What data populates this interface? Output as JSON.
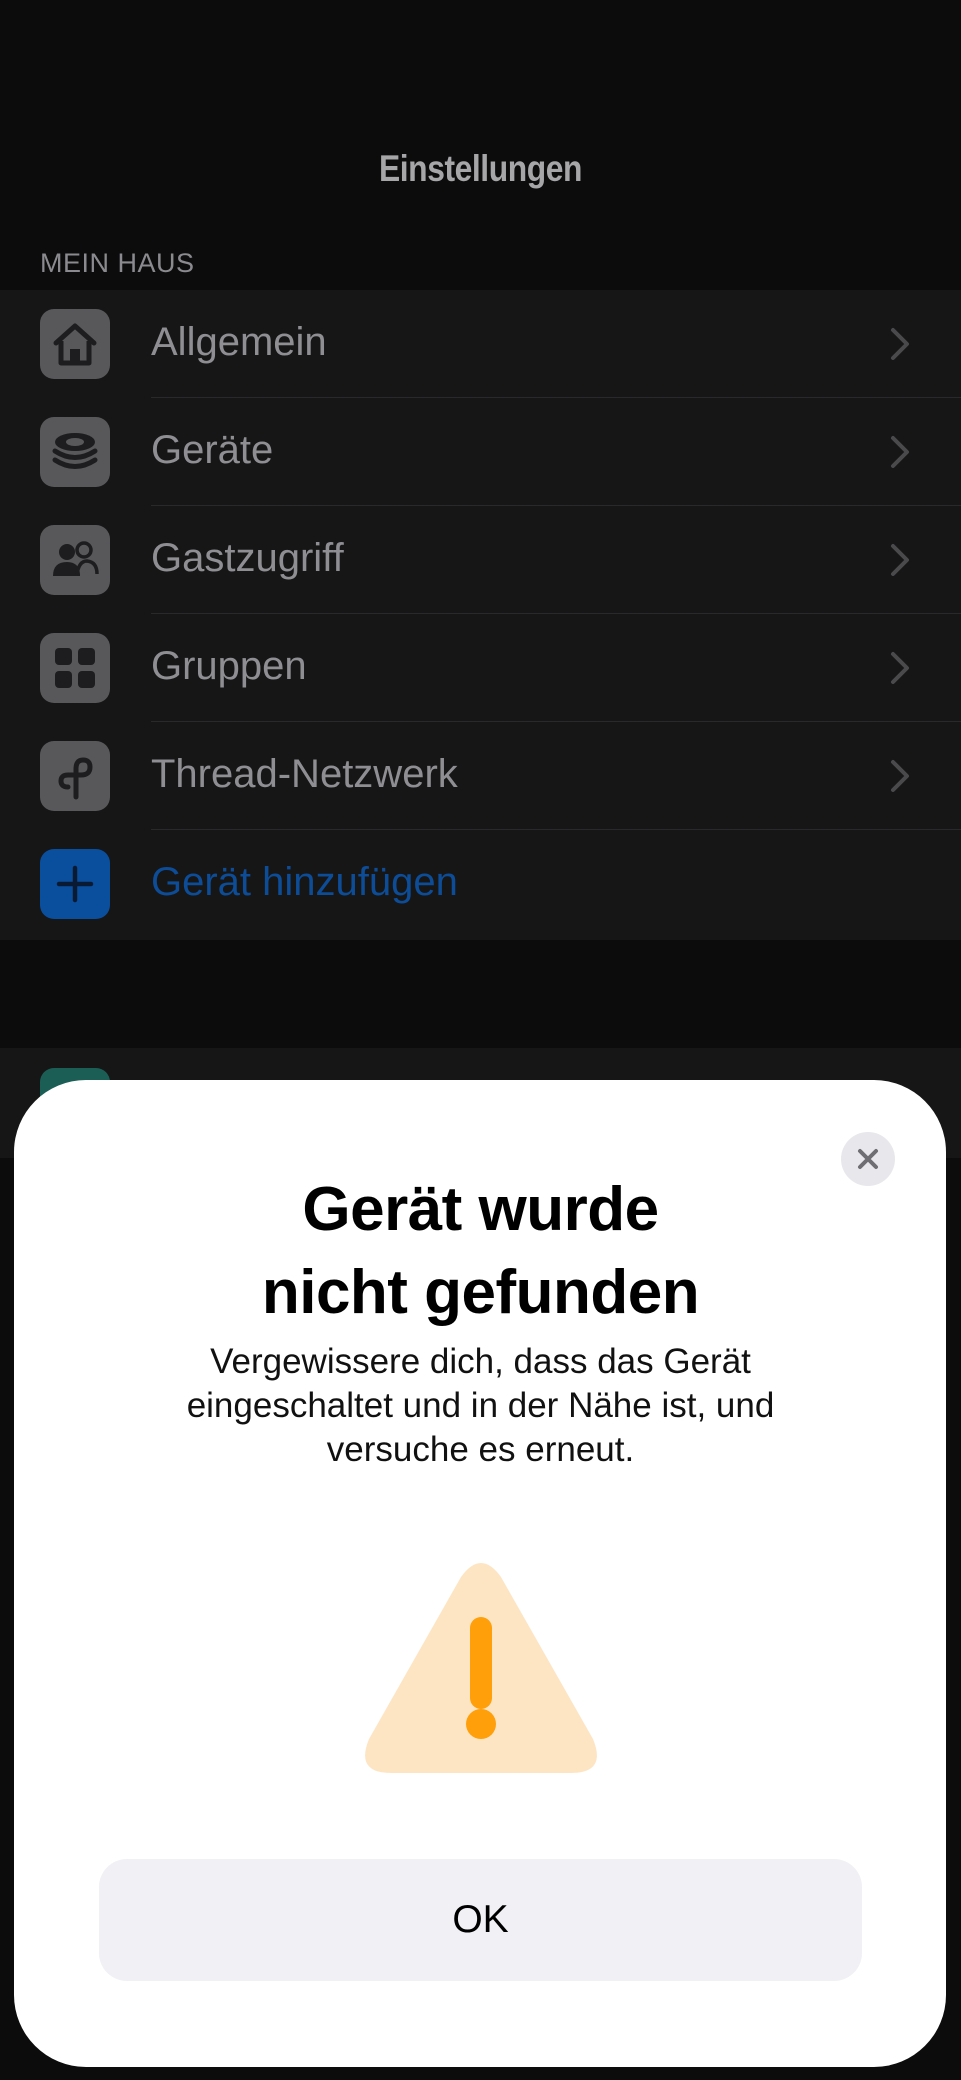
{
  "header": {
    "title": "Einstellungen"
  },
  "section": {
    "header": "MEIN HAUS"
  },
  "menu": {
    "items": [
      {
        "label": "Allgemein",
        "icon": "house-icon"
      },
      {
        "label": "Geräte",
        "icon": "devices-stack-icon"
      },
      {
        "label": "Gastzugriff",
        "icon": "guest-access-icon"
      },
      {
        "label": "Gruppen",
        "icon": "groups-grid-icon"
      },
      {
        "label": "Thread-Netzwerk",
        "icon": "thread-network-icon"
      },
      {
        "label": "Gerät hinzufügen",
        "icon": "plus-icon"
      }
    ]
  },
  "modal": {
    "title_line1": "Gerät wurde",
    "title_line2": "nicht gefunden",
    "message": "Vergewissere dich, dass das Gerät eingeschaltet und in der Nähe ist, und versuche es erneut.",
    "ok_label": "OK",
    "warning_icon": "warning-triangle-icon",
    "close_icon": "close-icon"
  },
  "colors": {
    "accent": "#0a84ff",
    "warning": "#ff9f0a",
    "warning_bg": "#fde5c4"
  }
}
